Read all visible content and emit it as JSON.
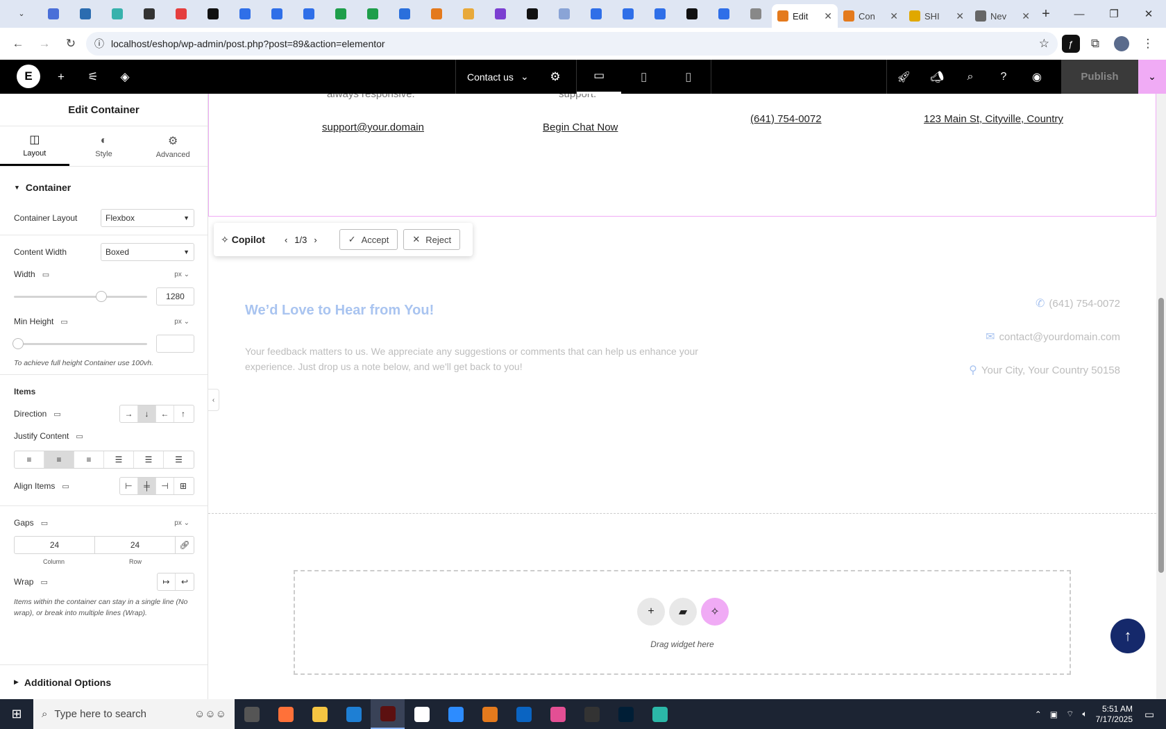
{
  "browser": {
    "pinned_tab_colors": [
      "#4a6fd8",
      "#2b6cb0",
      "#38b2ac",
      "#333333",
      "#e53e3e",
      "#111111",
      "#2f6fe8",
      "#2f6fe8",
      "#2f6fe8",
      "#1e9e4a",
      "#1e9e4a",
      "#2a6fdc",
      "#e47a1d",
      "#e8a93a",
      "#7b3fd1",
      "#111111",
      "#8aa4d6",
      "#2f6fe8",
      "#2f6fe8",
      "#2f6fe8",
      "#111111",
      "#2f6fe8",
      "#888888"
    ],
    "tabs": [
      {
        "title": "Edit",
        "active": true,
        "color": "#e47a1d"
      },
      {
        "title": "Con",
        "active": false,
        "color": "#e47a1d"
      },
      {
        "title": "SHI",
        "active": false,
        "color": "#e0a800"
      },
      {
        "title": "Nev",
        "active": false,
        "color": "#666666"
      }
    ],
    "url": "localhost/eshop/wp-admin/post.php?post=89&action=elementor"
  },
  "editor": {
    "page_name": "Contact us",
    "publish_label": "Publish",
    "accent_color": "#f0abf5"
  },
  "panel": {
    "title": "Edit Container",
    "tabs": [
      {
        "label": "Layout",
        "icon": "layout-icon",
        "active": true
      },
      {
        "label": "Style",
        "icon": "style-icon",
        "active": false
      },
      {
        "label": "Advanced",
        "icon": "gear-icon",
        "active": false
      }
    ],
    "section_title": "Container",
    "container_layout": {
      "label": "Container Layout",
      "value": "Flexbox"
    },
    "content_width": {
      "label": "Content Width",
      "value": "Boxed"
    },
    "width": {
      "label": "Width",
      "unit": "px",
      "value": "1280",
      "slider_fraction": 0.67
    },
    "min_height": {
      "label": "Min Height",
      "unit": "px",
      "value": "",
      "slider_fraction": 0.0
    },
    "min_height_hint": "To achieve full height Container use 100vh.",
    "items_title": "Items",
    "direction": {
      "label": "Direction",
      "selected_index": 1
    },
    "justify_content": {
      "label": "Justify Content",
      "selected_index": 1
    },
    "align_items": {
      "label": "Align Items",
      "selected_index": 1
    },
    "gaps": {
      "label": "Gaps",
      "unit": "px",
      "column": "24",
      "row": "24",
      "column_label": "Column",
      "row_label": "Row"
    },
    "wrap": {
      "label": "Wrap"
    },
    "wrap_hint": "Items within the container can stay in a single line (No wrap), or break into multiple lines (Wrap).",
    "additional_options": "Additional Options"
  },
  "canvas": {
    "top_section": {
      "faded_left": "always responsive.",
      "faded_right": "support.",
      "email_link": "support@your.domain",
      "chat_link": "Begin Chat Now",
      "phone_link": "(641) 754-0072",
      "address_link": "123 Main St, Cityville, Country"
    },
    "copilot": {
      "name": "Copilot",
      "counter": "1/3",
      "accept": "Accept",
      "reject": "Reject"
    },
    "feedback": {
      "title": "We’d Love to Hear from You!",
      "text": "Your feedback matters to us. We appreciate any suggestions or comments that can help us enhance your experience. Just drop us a note below, and we'll get back to you!",
      "phone": "(641) 754-0072",
      "email": "contact@yourdomain.com",
      "location": "Your City, Your Country 50158"
    },
    "dropzone_text": "Drag widget here"
  },
  "taskbar": {
    "search_placeholder": "Type here to search",
    "time": "5:51 AM",
    "date": "7/17/2025",
    "app_colors": [
      "#555555",
      "#ff7139",
      "#f5c542",
      "#1e7fd4",
      "#5c1010",
      "#ffffff",
      "#2d8cff",
      "#e47a1d",
      "#0a64c2",
      "#e34f94",
      "#333333",
      "#001e36",
      "#2bb8a8"
    ]
  }
}
